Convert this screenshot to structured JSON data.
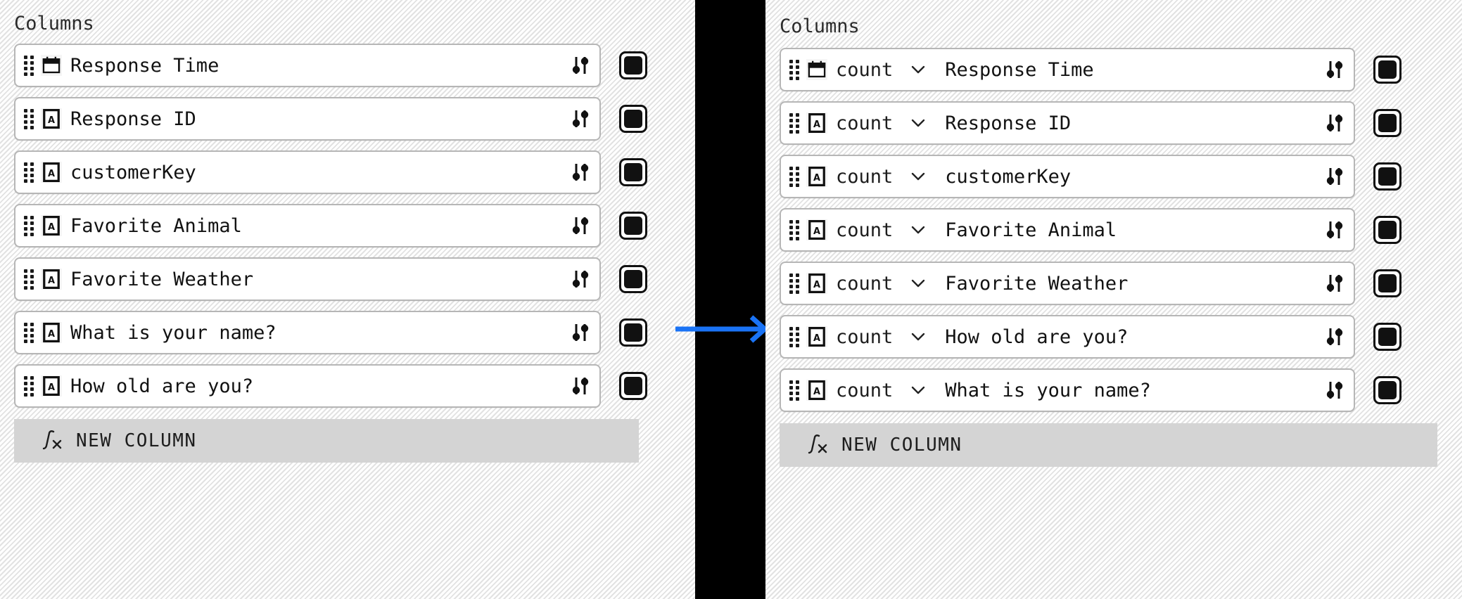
{
  "left_panel": {
    "section_label": "Columns",
    "rows": [
      {
        "type_icon": "calendar-icon",
        "name": "Response Time",
        "settings_icon": "sliders-icon",
        "checkbox": "checked"
      },
      {
        "type_icon": "text-a-icon",
        "name": "Response ID",
        "settings_icon": "sliders-icon",
        "checkbox": "checked"
      },
      {
        "type_icon": "text-a-icon",
        "name": "customerKey",
        "settings_icon": "sliders-icon",
        "checkbox": "checked"
      },
      {
        "type_icon": "text-a-icon",
        "name": "Favorite Animal",
        "settings_icon": "sliders-icon",
        "checkbox": "checked"
      },
      {
        "type_icon": "text-a-icon",
        "name": "Favorite Weather",
        "settings_icon": "sliders-icon",
        "checkbox": "checked"
      },
      {
        "type_icon": "text-a-icon",
        "name": "What is your name?",
        "settings_icon": "sliders-icon",
        "checkbox": "checked"
      },
      {
        "type_icon": "text-a-icon",
        "name": "How old are you?",
        "settings_icon": "sliders-icon",
        "checkbox": "checked"
      }
    ],
    "new_column": {
      "icon": "fx-icon",
      "label": "NEW COLUMN"
    }
  },
  "right_panel": {
    "section_label": "Columns",
    "rows": [
      {
        "type_icon": "calendar-icon",
        "aggregation": "count",
        "chevron": "chevron-down-icon",
        "name": "Response Time",
        "settings_icon": "sliders-icon",
        "checkbox": "checked"
      },
      {
        "type_icon": "text-a-icon",
        "aggregation": "count",
        "chevron": "chevron-down-icon",
        "name": "Response ID",
        "settings_icon": "sliders-icon",
        "checkbox": "checked"
      },
      {
        "type_icon": "text-a-icon",
        "aggregation": "count",
        "chevron": "chevron-down-icon",
        "name": "customerKey",
        "settings_icon": "sliders-icon",
        "checkbox": "checked"
      },
      {
        "type_icon": "text-a-icon",
        "aggregation": "count",
        "chevron": "chevron-down-icon",
        "name": "Favorite Animal",
        "settings_icon": "sliders-icon",
        "checkbox": "checked"
      },
      {
        "type_icon": "text-a-icon",
        "aggregation": "count",
        "chevron": "chevron-down-icon",
        "name": "Favorite Weather",
        "settings_icon": "sliders-icon",
        "checkbox": "checked"
      },
      {
        "type_icon": "text-a-icon",
        "aggregation": "count",
        "chevron": "chevron-down-icon",
        "name": "How old are you?",
        "settings_icon": "sliders-icon",
        "checkbox": "checked"
      },
      {
        "type_icon": "text-a-icon",
        "aggregation": "count",
        "chevron": "chevron-down-icon",
        "name": "What is your name?",
        "settings_icon": "sliders-icon",
        "checkbox": "checked"
      }
    ],
    "new_column": {
      "icon": "fx-icon",
      "label": "NEW COLUMN"
    }
  },
  "divider": {
    "arrow_icon": "arrow-right-icon",
    "arrow_color": "#1a73f5",
    "band_color": "#000000"
  },
  "colors": {
    "card_border": "#b6b6b6",
    "card_bg": "#ffffff",
    "checkbox_fill": "#111111",
    "new_column_bg": "#d4d4d4",
    "text": "#121212"
  }
}
